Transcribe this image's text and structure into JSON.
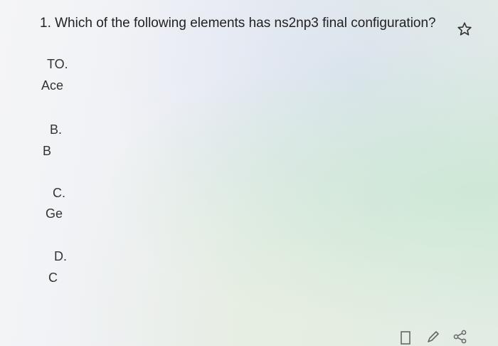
{
  "question": {
    "text": "1. Which of the following elements has ns2np3 final configuration?"
  },
  "icons": {
    "favorite": "star-outline-icon",
    "document": "document-icon",
    "edit": "pencil-icon",
    "share": "share-icon"
  },
  "options": [
    {
      "letter": "TO.",
      "text": "Ace"
    },
    {
      "letter": "B.",
      "text": "B"
    },
    {
      "letter": "C.",
      "text": "Ge"
    },
    {
      "letter": "D.",
      "text": "C"
    }
  ],
  "colors": {
    "text": "#222222",
    "background": "#eef0f4"
  }
}
